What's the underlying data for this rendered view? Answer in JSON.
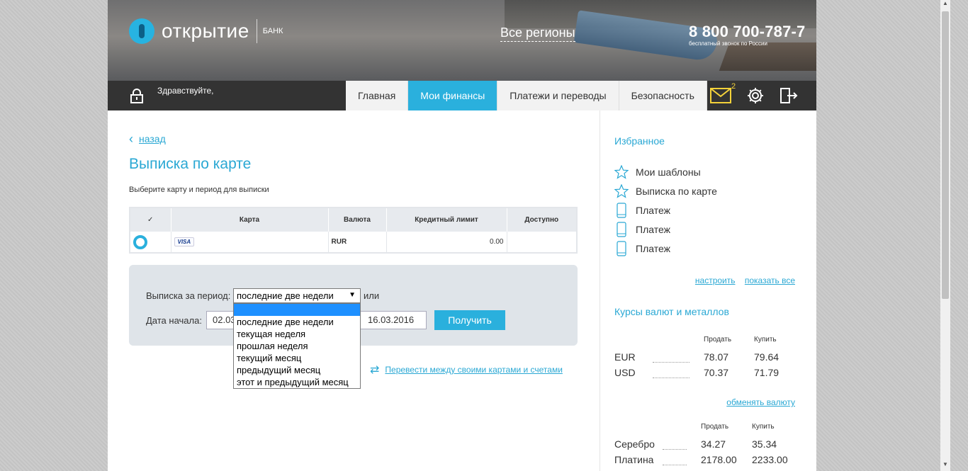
{
  "colors": {
    "accent": "#2ab0dd",
    "nav_bg": "#333333",
    "panel_bg": "#dfe4e9"
  },
  "header": {
    "logo_name": "открытие",
    "logo_sub": "БАНК",
    "regions": "Все регионы",
    "phone": "8 800 700-787-7",
    "phone_note": "бесплатный звонок по России"
  },
  "nav": {
    "greeting": "Здравствуйте,",
    "tabs": [
      {
        "label": "Главная",
        "active": false
      },
      {
        "label": "Мои финансы",
        "active": true
      },
      {
        "label": "Платежи и переводы",
        "active": false
      },
      {
        "label": "Безопасность",
        "active": false
      }
    ],
    "mail_count": "2",
    "icons": [
      "lock-icon",
      "mail-icon",
      "gear-icon",
      "exit-icon"
    ]
  },
  "main": {
    "back": "назад",
    "title": "Выписка по карте",
    "subtitle": "Выберите карту и период для выписки",
    "table": {
      "headers": [
        "✓",
        "Карта",
        "Валюта",
        "Кредитный лимит",
        "Доступно"
      ],
      "rows": [
        {
          "card": "VISA",
          "currency": "RUR",
          "limit": "0.00",
          "available": ""
        }
      ]
    },
    "period": {
      "label": "Выписка за период:",
      "selected": "последние две недели",
      "or": "или",
      "start_label": "Дата начала:",
      "start_date": "02.03.2016",
      "end_date": "16.03.2016",
      "submit": "Получить",
      "options": [
        "",
        "последние две недели",
        "текущая неделя",
        "прошлая неделя",
        "текущий месяц",
        "предыдущий месяц",
        "этот и предыдущий месяц"
      ]
    },
    "transfer_link": "Перевести между своими картами и счетами"
  },
  "sidebar": {
    "favorites_title": "Избранное",
    "favorites": [
      {
        "label": "Мои шаблоны",
        "icon": "star-icon"
      },
      {
        "label": "Выписка по карте",
        "icon": "star-icon"
      },
      {
        "label": "Платеж",
        "icon": "phone-icon"
      },
      {
        "label": "Платеж",
        "icon": "phone-icon"
      },
      {
        "label": "Платеж",
        "icon": "phone-icon"
      }
    ],
    "configure": "настроить",
    "show_all": "показать все",
    "rates_title": "Курсы валют и металлов",
    "sell": "Продать",
    "buy": "Купить",
    "currencies": [
      {
        "code": "EUR",
        "sell": "78.07",
        "buy": "79.64"
      },
      {
        "code": "USD",
        "sell": "70.37",
        "buy": "71.79"
      }
    ],
    "exchange": "обменять валюту",
    "metals": [
      {
        "name": "Серебро",
        "sell": "34.27",
        "buy": "35.34"
      },
      {
        "name": "Платина",
        "sell": "2178.00",
        "buy": "2233.00"
      }
    ]
  }
}
